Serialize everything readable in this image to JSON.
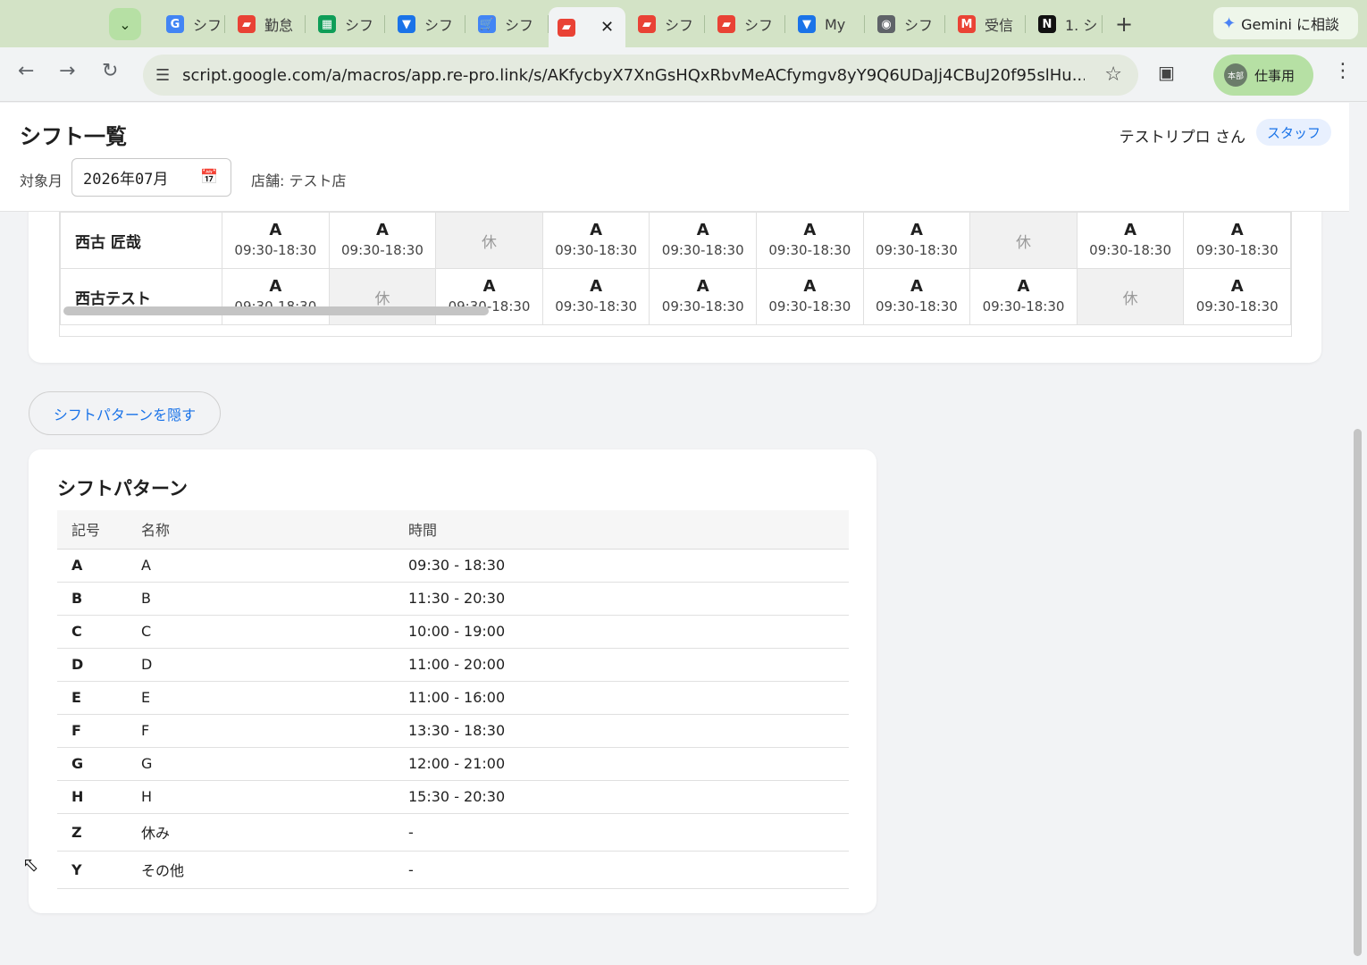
{
  "browser": {
    "tabs": [
      {
        "label": "シフ",
        "icon": "google-icon",
        "color": "#4285f4"
      },
      {
        "label": "勤怠",
        "icon": "apps-script-icon",
        "color": "#e94235"
      },
      {
        "label": "シフ",
        "icon": "sheets-icon",
        "color": "#0f9d58"
      },
      {
        "label": "シフ",
        "icon": "forms-icon",
        "color": "#1a73e8"
      },
      {
        "label": "シフ",
        "icon": "cart-icon",
        "color": "#4285f4"
      },
      {
        "label": "",
        "icon": "apps-script-icon",
        "color": "#e94235"
      },
      {
        "label": "シフ",
        "icon": "apps-script-icon",
        "color": "#e94235"
      },
      {
        "label": "シフ",
        "icon": "apps-script-icon",
        "color": "#e94235"
      },
      {
        "label": "My",
        "icon": "forms-icon",
        "color": "#1a73e8"
      },
      {
        "label": "シフ",
        "icon": "globe-icon",
        "color": "#5f6368"
      },
      {
        "label": "受信",
        "icon": "gmail-icon",
        "color": "#ea4335"
      },
      {
        "label": "1. シ",
        "icon": "notion-icon",
        "color": "#111111"
      }
    ],
    "gemini_label": "Gemini に相談",
    "url": "script.google.com/a/macros/app.re-pro.link/s/AKfycbyX7XnGsHQxRbvMeACfymgv8yY9Q6UDaJj4CBuJ20f95slHu...",
    "profile_label": "仕事用",
    "profile_avatar": "本部"
  },
  "header": {
    "title": "シフト一覧",
    "user": "テストリプロ さん",
    "role": "スタッフ",
    "month_label": "対象月",
    "month_value": "2026年07月",
    "store": "店舗: テスト店"
  },
  "schedule": {
    "rows": [
      {
        "name": "西古 匠哉",
        "cells": [
          {
            "sym": "A",
            "time": "09:30-18:30"
          },
          {
            "sym": "A",
            "time": "09:30-18:30"
          },
          {
            "off": "休"
          },
          {
            "sym": "A",
            "time": "09:30-18:30"
          },
          {
            "sym": "A",
            "time": "09:30-18:30"
          },
          {
            "sym": "A",
            "time": "09:30-18:30"
          },
          {
            "sym": "A",
            "time": "09:30-18:30"
          },
          {
            "off": "休"
          },
          {
            "sym": "A",
            "time": "09:30-18:30"
          },
          {
            "sym": "A",
            "time": "09:30-18:30"
          }
        ]
      },
      {
        "name": "西古テスト",
        "cells": [
          {
            "sym": "A",
            "time": "09:30-18:30"
          },
          {
            "off": "休"
          },
          {
            "sym": "A",
            "time": "09:30-18:30"
          },
          {
            "sym": "A",
            "time": "09:30-18:30"
          },
          {
            "sym": "A",
            "time": "09:30-18:30"
          },
          {
            "sym": "A",
            "time": "09:30-18:30"
          },
          {
            "sym": "A",
            "time": "09:30-18:30"
          },
          {
            "sym": "A",
            "time": "09:30-18:30"
          },
          {
            "off": "休"
          },
          {
            "sym": "A",
            "time": "09:30-18:30"
          }
        ]
      }
    ]
  },
  "toggle_label": "シフトパターンを隠す",
  "patterns": {
    "title": "シフトパターン",
    "headers": [
      "記号",
      "名称",
      "時間"
    ],
    "rows": [
      [
        "A",
        "A",
        "09:30 - 18:30"
      ],
      [
        "B",
        "B",
        "11:30 - 20:30"
      ],
      [
        "C",
        "C",
        "10:00 - 19:00"
      ],
      [
        "D",
        "D",
        "11:00 - 20:00"
      ],
      [
        "E",
        "E",
        "11:00 - 16:00"
      ],
      [
        "F",
        "F",
        "13:30 - 18:30"
      ],
      [
        "G",
        "G",
        "12:00 - 21:00"
      ],
      [
        "H",
        "H",
        "15:30 - 20:30"
      ],
      [
        "Z",
        "休み",
        "-"
      ],
      [
        "Y",
        "その他",
        "-"
      ]
    ]
  }
}
